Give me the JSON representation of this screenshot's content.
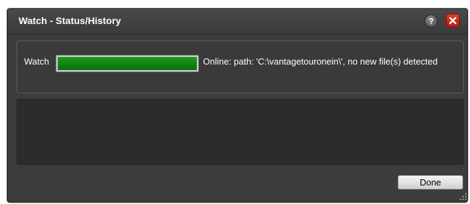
{
  "dialog": {
    "title": "Watch - Status/History",
    "help_icon": "help-icon",
    "help_glyph": "?",
    "close_icon": "close-icon"
  },
  "status": {
    "label": "Watch",
    "progress": 1.0,
    "message": "Online: path: 'C:\\vantagetouronein\\', no new file(s) detected"
  },
  "footer": {
    "done_label": "Done"
  },
  "colors": {
    "dialog_bg": "#3c3c3c",
    "progress_green": "#0a7d0a",
    "close_red": "#d0281c"
  }
}
